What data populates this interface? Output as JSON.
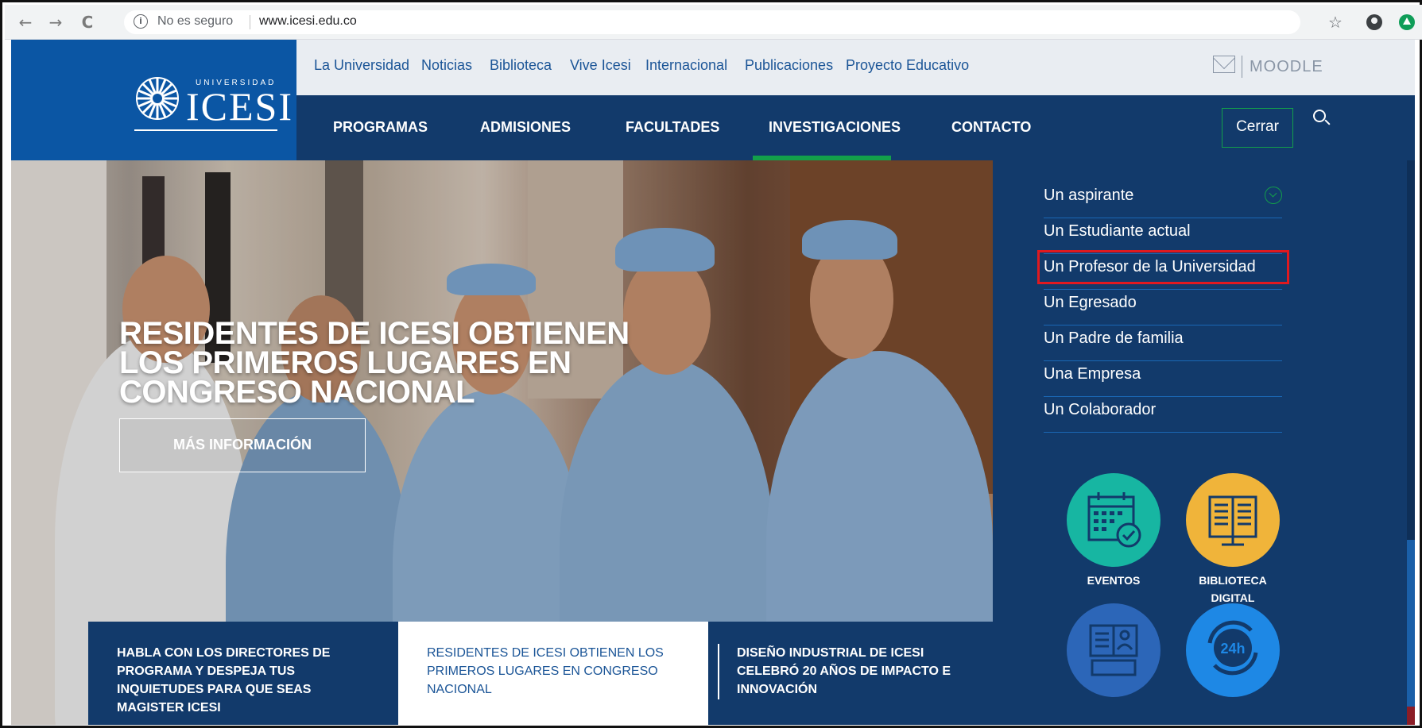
{
  "browser": {
    "back": "←",
    "forward": "→",
    "reload": "C",
    "security_text": "No es seguro",
    "url": "www.icesi.edu.co",
    "star": "☆"
  },
  "logo": {
    "small": "UNIVERSIDAD",
    "big": "ICESI"
  },
  "topnav": [
    "La Universidad",
    "Noticias",
    "Biblioteca",
    "Vive Icesi",
    "Internacional",
    "Publicaciones",
    "Proyecto Educativo"
  ],
  "moodle": "MOODLE",
  "mainnav": [
    "PROGRAMAS",
    "ADMISIONES",
    "FACULTADES",
    "INVESTIGACIONES",
    "CONTACTO"
  ],
  "active_main": "INVESTIGACIONES",
  "close_label": "Cerrar",
  "hero": {
    "title": "RESIDENTES DE ICESI OBTIENEN LOS PRIMEROS LUGARES EN CONGRESO NACIONAL",
    "button": "MÁS INFORMACIÓN"
  },
  "news": [
    "HABLA CON LOS DIRECTORES DE PROGRAMA Y DESPEJA TUS INQUIETUDES PARA QUE SEAS MAGISTER ICESI",
    "RESIDENTES DE ICESI OBTIENEN LOS PRIMEROS LUGARES EN CONGRESO NACIONAL",
    "DISEÑO INDUSTRIAL DE ICESI CELEBRÓ 20 AÑOS DE IMPACTO E INNOVACIÓN"
  ],
  "menu": [
    "Un aspirante",
    "Un Estudiante actual",
    "Un Profesor de la Universidad",
    "Un Egresado",
    "Un Padre de familia",
    "Una Empresa",
    "Un Colaborador"
  ],
  "highlighted_menu": "Un Profesor de la Universidad",
  "tiles": [
    {
      "label": "EVENTOS",
      "icon": "calendar-check-icon",
      "color": "#17b6a2"
    },
    {
      "label": "BIBLIOTECA DIGITAL",
      "icon": "book-icon",
      "color": "#f0b43a"
    },
    {
      "label": "",
      "icon": "directory-icon",
      "color": "#2c66b8"
    },
    {
      "label": "",
      "icon": "24h-icon",
      "color": "#1e88e5"
    }
  ],
  "tile_24h_text": "24h",
  "colors": {
    "navy": "#123a6b",
    "logo_blue": "#0b56a4",
    "green_accent": "#13a04a",
    "highlight_red": "#e0191f"
  }
}
